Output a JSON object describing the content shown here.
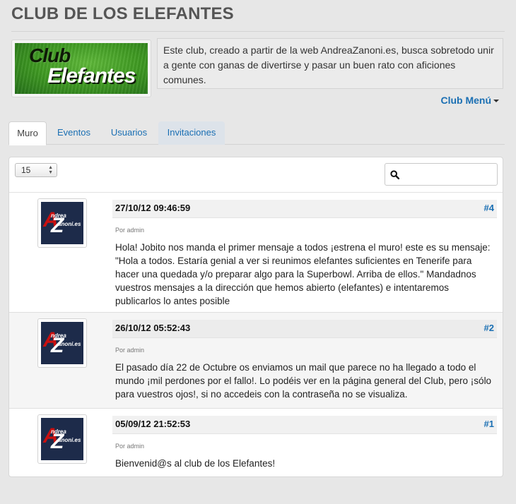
{
  "header": {
    "title": "CLUB DE LOS ELEFANTES"
  },
  "logo": {
    "line1": "Club",
    "line2": "Elefantes"
  },
  "description": "Este club, creado a partir de la web AndreaZanoni.es, busca sobretodo unir a gente con ganas de divertirse y pasar un buen rato con aficiones comunes.",
  "club_menu": {
    "label": "Club Menú"
  },
  "tabs": [
    {
      "label": "Muro",
      "active": true
    },
    {
      "label": "Eventos"
    },
    {
      "label": "Usuarios"
    },
    {
      "label": "Invitaciones"
    }
  ],
  "toolbar": {
    "per_page": "15",
    "search_placeholder": "",
    "search_icon": "search-icon"
  },
  "avatar": {
    "line1": "ndrea",
    "line2": "anoni.es"
  },
  "posts": [
    {
      "date": "27/10/12 09:46:59",
      "number": "#4",
      "author": "Por admin",
      "body": "Hola! Jobito nos manda el primer mensaje a todos ¡estrena el muro! este es su mensaje: \"Hola a todos. Estaría genial a ver si reunimos elefantes suficientes en Tenerife para hacer una quedada y/o preparar algo para la Superbowl. Arriba de ellos.\" Mandadnos vuestros mensajes a la dirección que hemos abierto (elefantes) e intentaremos publicarlos lo antes posible"
    },
    {
      "date": "26/10/12 05:52:43",
      "number": "#2",
      "author": "Por admin",
      "body": "El pasado día 22 de Octubre os enviamos un mail que parece no ha llegado a todo el mundo ¡mil perdones por el fallo!. Lo podéis ver en la página general del Club, pero ¡sólo para vuestros ojos!, si no accedeis con la contraseña no se visualiza."
    },
    {
      "date": "05/09/12 21:52:53",
      "number": "#1",
      "author": "Por admin",
      "body": "Bienvenid@s al club de los Elefantes!"
    }
  ],
  "colors": {
    "link": "#1a6fb3",
    "background": "#e7e7e7"
  }
}
